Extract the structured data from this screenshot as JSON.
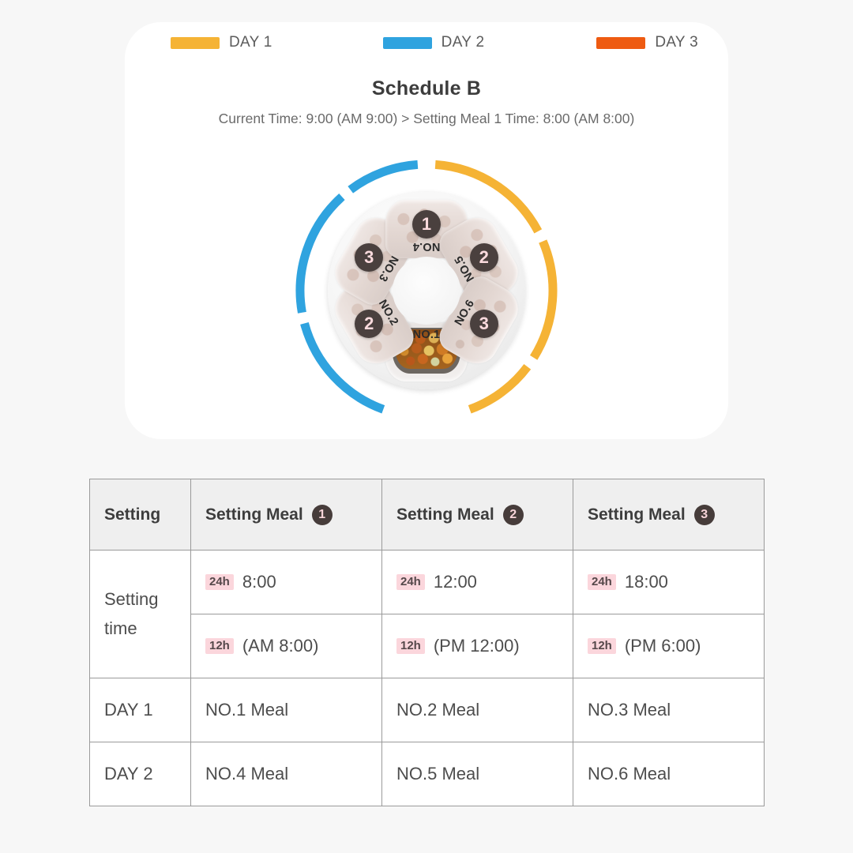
{
  "legend": {
    "items": [
      {
        "label": "DAY 1",
        "color": "#f5b335"
      },
      {
        "label": "DAY 2",
        "color": "#2fa3df"
      },
      {
        "label": "DAY 3",
        "color": "#ee5b12"
      }
    ]
  },
  "schedule": {
    "title": "Schedule B",
    "subtitle": "Current Time: 9:00 (AM 9:00) > Setting Meal 1 Time: 8:00 (AM 8:00)"
  },
  "wheel": {
    "slots": [
      {
        "name": "NO.1",
        "badge": "",
        "filled": true,
        "angle": 180
      },
      {
        "name": "NO.2",
        "badge": "2",
        "filled": false,
        "angle": 240
      },
      {
        "name": "NO.3",
        "badge": "3",
        "filled": false,
        "angle": 300
      },
      {
        "name": "NO.4",
        "badge": "1",
        "filled": false,
        "angle": 0
      },
      {
        "name": "NO.5",
        "badge": "2",
        "filled": false,
        "angle": 60
      },
      {
        "name": "NO.6",
        "badge": "3",
        "filled": false,
        "angle": 120
      }
    ],
    "ring": {
      "day1_color": "#f5b335",
      "day2_color": "#2fa3df",
      "arcs": [
        {
          "day": "DAY 2",
          "color": "#2fa3df",
          "start": 200,
          "end": 255
        },
        {
          "day": "DAY 2",
          "color": "#2fa3df",
          "start": 260,
          "end": 318
        },
        {
          "day": "DAY 2",
          "color": "#2fa3df",
          "start": 323,
          "end": 356
        },
        {
          "day": "DAY 1",
          "color": "#f5b335",
          "start": 4,
          "end": 62
        },
        {
          "day": "DAY 1",
          "color": "#f5b335",
          "start": 67,
          "end": 122
        },
        {
          "day": "DAY 1",
          "color": "#f5b335",
          "start": 127,
          "end": 160
        }
      ]
    }
  },
  "table": {
    "headers": [
      {
        "label": "Setting",
        "badge": ""
      },
      {
        "label": "Setting Meal",
        "badge": "1"
      },
      {
        "label": "Setting Meal",
        "badge": "2"
      },
      {
        "label": "Setting Meal",
        "badge": "3"
      }
    ],
    "setting_time_label": "Setting time",
    "rows_24h": {
      "chip": "24h",
      "values": [
        "8:00",
        "12:00",
        "18:00"
      ]
    },
    "rows_12h": {
      "chip": "12h",
      "values": [
        "(AM 8:00)",
        "(PM 12:00)",
        "(PM 6:00)"
      ]
    },
    "day_rows": [
      {
        "label": "DAY 1",
        "values": [
          "NO.1 Meal",
          "NO.2 Meal",
          "NO.3 Meal"
        ]
      },
      {
        "label": "DAY 2",
        "values": [
          "NO.4 Meal",
          "NO.5 Meal",
          "NO.6 Meal"
        ]
      }
    ]
  }
}
